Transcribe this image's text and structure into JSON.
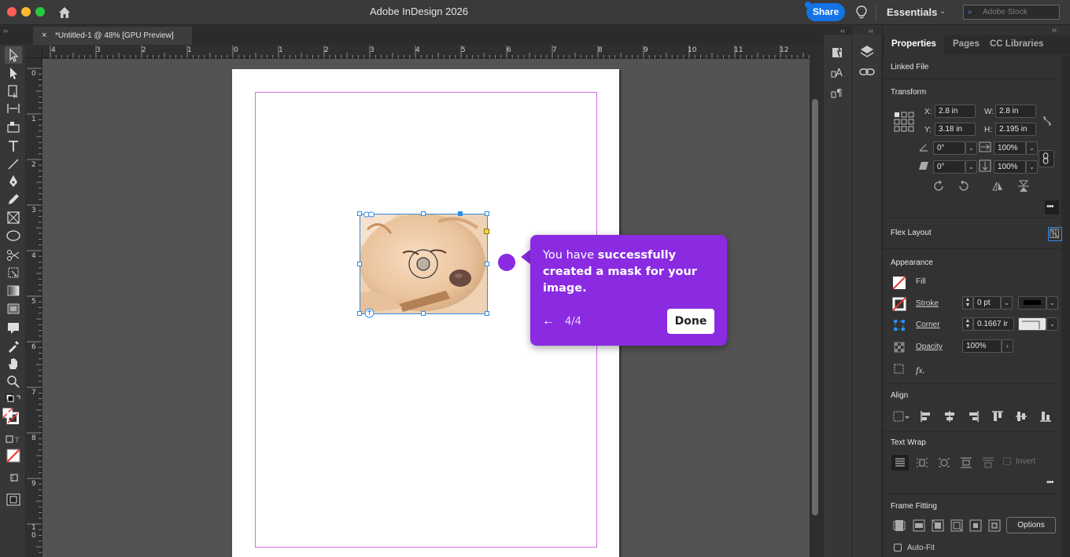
{
  "window": {
    "title": "Adobe InDesign 2026",
    "share_label": "Share",
    "workspace": "Essentials",
    "stock_placeholder": "Adobe Stock"
  },
  "document_tab": {
    "name": "*Untitled-1 @ 48% [GPU Preview]",
    "close_glyph": "×"
  },
  "ruler": {
    "horizontal": [
      "4",
      "3",
      "2",
      "1",
      "0",
      "1",
      "2",
      "3",
      "4",
      "5",
      "6",
      "7",
      "8",
      "9",
      "10",
      "11",
      "12"
    ],
    "vertical": [
      "0",
      "1",
      "2",
      "3",
      "4",
      "5",
      "6",
      "7",
      "8",
      "9",
      "1",
      "0"
    ]
  },
  "coach_mark": {
    "message_pre": "You have ",
    "message_bold": "successfully created a mask for your image.",
    "step": "4/4",
    "back_glyph": "←",
    "done_label": "Done",
    "color": "#8a2be2"
  },
  "panel": {
    "tabs": [
      "Properties",
      "Pages",
      "CC Libraries"
    ],
    "linked_file": "Linked File",
    "transform": {
      "title": "Transform",
      "x_label": "X:",
      "x": "2.8 in",
      "y_label": "Y:",
      "y": "3.18 in",
      "w_label": "W:",
      "w": "2.8 in",
      "h_label": "H:",
      "h": "2.195 in",
      "rotate": "0°",
      "shear": "0°",
      "scale_x": "100%",
      "scale_y": "100%"
    },
    "flex_layout": "Flex Layout",
    "appearance": {
      "title": "Appearance",
      "fill": "Fill",
      "stroke": "Stroke",
      "stroke_value": "0 pt",
      "corner": "Corner",
      "corner_value": "0.1667 ir",
      "opacity": "Opacity",
      "opacity_value": "100%",
      "fx": "fx."
    },
    "align": "Align",
    "text_wrap": {
      "title": "Text Wrap",
      "invert": "Invert"
    },
    "frame_fitting": {
      "title": "Frame Fitting",
      "options": "Options",
      "auto_fit": "Auto-Fit"
    }
  },
  "colors": {
    "accent_blue": "#1473e6",
    "selection_blue": "#2d8ceb",
    "margin_guide": "#d36be8"
  }
}
